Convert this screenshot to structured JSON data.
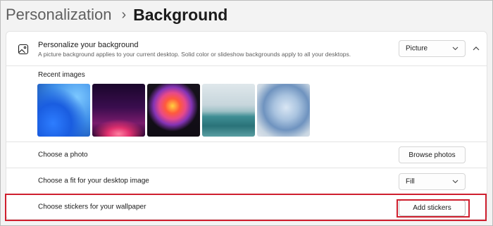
{
  "breadcrumb": {
    "parent": "Personalization",
    "separator": "›",
    "current": "Background"
  },
  "background_card": {
    "icon": "picture-icon",
    "title": "Personalize your background",
    "description": "A picture background applies to your current desktop. Solid color or slideshow backgrounds apply to all your desktops.",
    "type_select_value": "Picture",
    "expanded": true
  },
  "recent_images": {
    "label": "Recent images",
    "items": [
      "blue-bloom-wallpaper",
      "purple-glow-wallpaper",
      "colorful-ribbon-wallpaper",
      "lake-sunrise-wallpaper",
      "soft-blue-bloom-wallpaper"
    ]
  },
  "choose_photo": {
    "label": "Choose a photo",
    "button_label": "Browse photos"
  },
  "choose_fit": {
    "label": "Choose a fit for your desktop image",
    "select_value": "Fill"
  },
  "stickers": {
    "label": "Choose stickers for your wallpaper",
    "button_label": "Add stickers",
    "highlighted": true,
    "highlight_color": "#cf1f2e"
  }
}
